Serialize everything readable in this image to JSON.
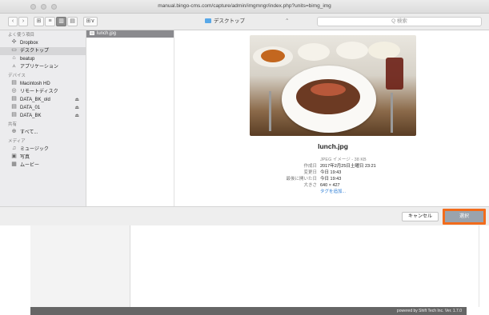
{
  "window": {
    "title": "manual.bingo-cms.com/capture/admin/imgmngr/index.php?units=bimg_img"
  },
  "toolbar": {
    "back_glyph": "‹",
    "forward_glyph": "›",
    "view_icon": "⊞",
    "view_list": "≡",
    "view_columns": "▥",
    "view_coverflow": "▤",
    "arrange": "⊞∨",
    "location": "デスクトップ",
    "location_chevron": "⌃",
    "search_placeholder": "Q 検索"
  },
  "sidebar": {
    "sections": [
      {
        "label": "よく使う項目",
        "items": [
          {
            "label": "Dropbox",
            "icon": "✣",
            "eject": ""
          },
          {
            "label": "デスクトップ",
            "icon": "▭",
            "eject": "",
            "selected": true
          },
          {
            "label": "beatup",
            "icon": "⌂",
            "eject": ""
          },
          {
            "label": "アプリケーション",
            "icon": "⩑",
            "eject": ""
          }
        ]
      },
      {
        "label": "デバイス",
        "items": [
          {
            "label": "Macintosh HD",
            "icon": "▤",
            "eject": ""
          },
          {
            "label": "リモートディスク",
            "icon": "◎",
            "eject": ""
          },
          {
            "label": "DATA_BK_old",
            "icon": "▤",
            "eject": "⏏"
          },
          {
            "label": "DATA_01",
            "icon": "▤",
            "eject": "⏏"
          },
          {
            "label": "DATA_BK",
            "icon": "▤",
            "eject": "⏏"
          }
        ]
      },
      {
        "label": "共有",
        "items": [
          {
            "label": "すべて...",
            "icon": "⊕",
            "eject": ""
          }
        ]
      },
      {
        "label": "メディア",
        "items": [
          {
            "label": "ミュージック",
            "icon": "♫",
            "eject": ""
          },
          {
            "label": "写真",
            "icon": "▣",
            "eject": ""
          },
          {
            "label": "ムービー",
            "icon": "▦",
            "eject": ""
          }
        ]
      }
    ]
  },
  "column": {
    "selected_file": "lunch.jpg"
  },
  "preview": {
    "file_name": "lunch.jpg",
    "type_value": "JPEG イメージ - 38 KB",
    "created_label": "作成日",
    "created_value": "2017年2月25日土曜日 23:21",
    "modified_label": "変更日",
    "modified_value": "今日 19:43",
    "opened_label": "最後に開いた日",
    "opened_value": "今日 19:43",
    "size_label": "大きさ",
    "size_value": "640 × 427",
    "tags_link": "タグを追加..."
  },
  "buttons": {
    "cancel": "キャンセル",
    "select": "選択"
  },
  "footer": {
    "text": "powered by Shift Tech Inc. Ver. 1.7.0"
  }
}
